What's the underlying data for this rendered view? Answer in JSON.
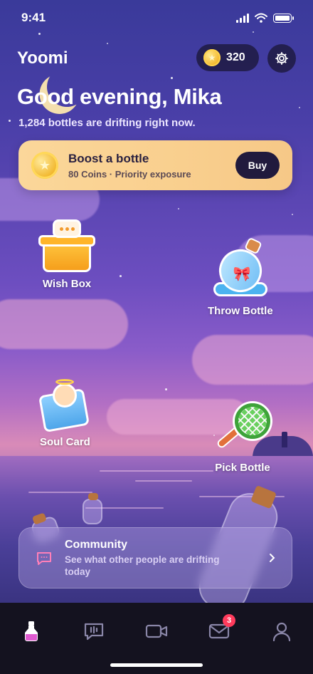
{
  "status_bar": {
    "time": "9:41"
  },
  "header": {
    "brand": "Yoomi",
    "coins": "320",
    "greeting": "Good evening, Mika",
    "subline": "1,284 bottles are drifting right now."
  },
  "boost": {
    "title": "Boost a bottle",
    "description": "80 Coins · Priority exposure",
    "buy_label": "Buy"
  },
  "features": {
    "wish_box": "Wish Box",
    "throw_bottle": "Throw Bottle",
    "soul_card": "Soul Card",
    "pick_bottle": "Pick Bottle"
  },
  "community": {
    "title": "Community",
    "subtitle": "See what other people are drifting today"
  },
  "tabbar": {
    "messages_badge": "3",
    "active_tab": "bottle"
  },
  "colors": {
    "accent_gold": "#f9cf8e",
    "dark_button": "#211a3d",
    "badge_red": "#ff3b5c",
    "active_tab_pink": "#e05bd0"
  }
}
